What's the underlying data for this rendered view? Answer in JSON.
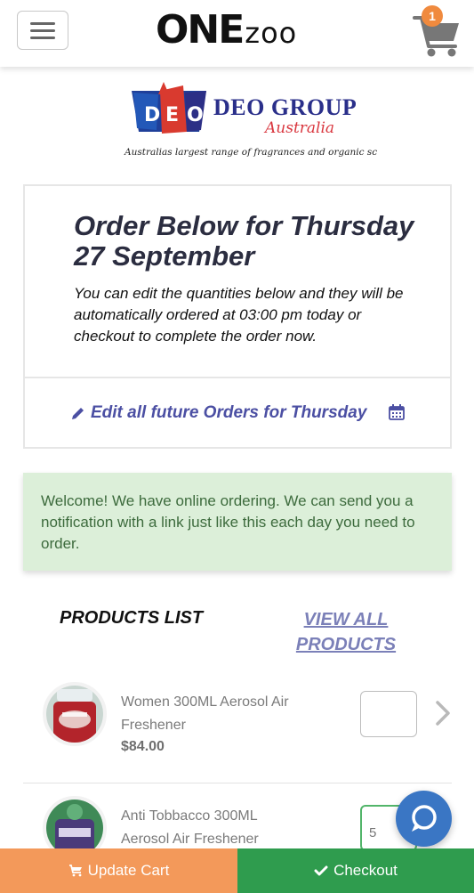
{
  "header": {
    "brand_bold": "ONE",
    "brand_light": "zoo",
    "cart_count": "1"
  },
  "logo": {
    "letters": [
      "D",
      "E",
      "O"
    ],
    "name": "DEO GROUP",
    "sub": "Australia",
    "tagline": "Australias largest range of fragrances and organic sc"
  },
  "order": {
    "title": "Order Below for Thursday 27 September",
    "description": "You can edit the quantities below and they will be automatically ordered at 03:00 pm today or checkout to complete the order now.",
    "edit_link": "Edit all future Orders for Thursday"
  },
  "alert": {
    "text": "Welcome! We have online ordering. We can send you a notification with a link just like this each day you need to order."
  },
  "products_section": {
    "title": "PRODUCTS LIST",
    "view_all": "VIEW ALL PRODUCTS"
  },
  "products": [
    {
      "name": "Women 300ML Aerosol Air Freshener",
      "price": "$84.00",
      "quantity": ""
    },
    {
      "name": "Anti Tobbacco 300ML Aerosol Air Freshener",
      "price": "",
      "quantity": "5"
    }
  ],
  "footer": {
    "update_label": "Update Cart",
    "checkout_label": "Checkout"
  },
  "colors": {
    "accent_orange": "#f3995a",
    "accent_green": "#2f9c4e",
    "chat_blue": "#3a76c4",
    "alert_bg": "#dcefd9",
    "link_purple": "#4b4fa3"
  },
  "icons": [
    "hamburger-menu-icon",
    "cart-icon",
    "pencil-icon",
    "calendar-icon",
    "chevron-right-icon",
    "chat-icon",
    "check-icon"
  ]
}
